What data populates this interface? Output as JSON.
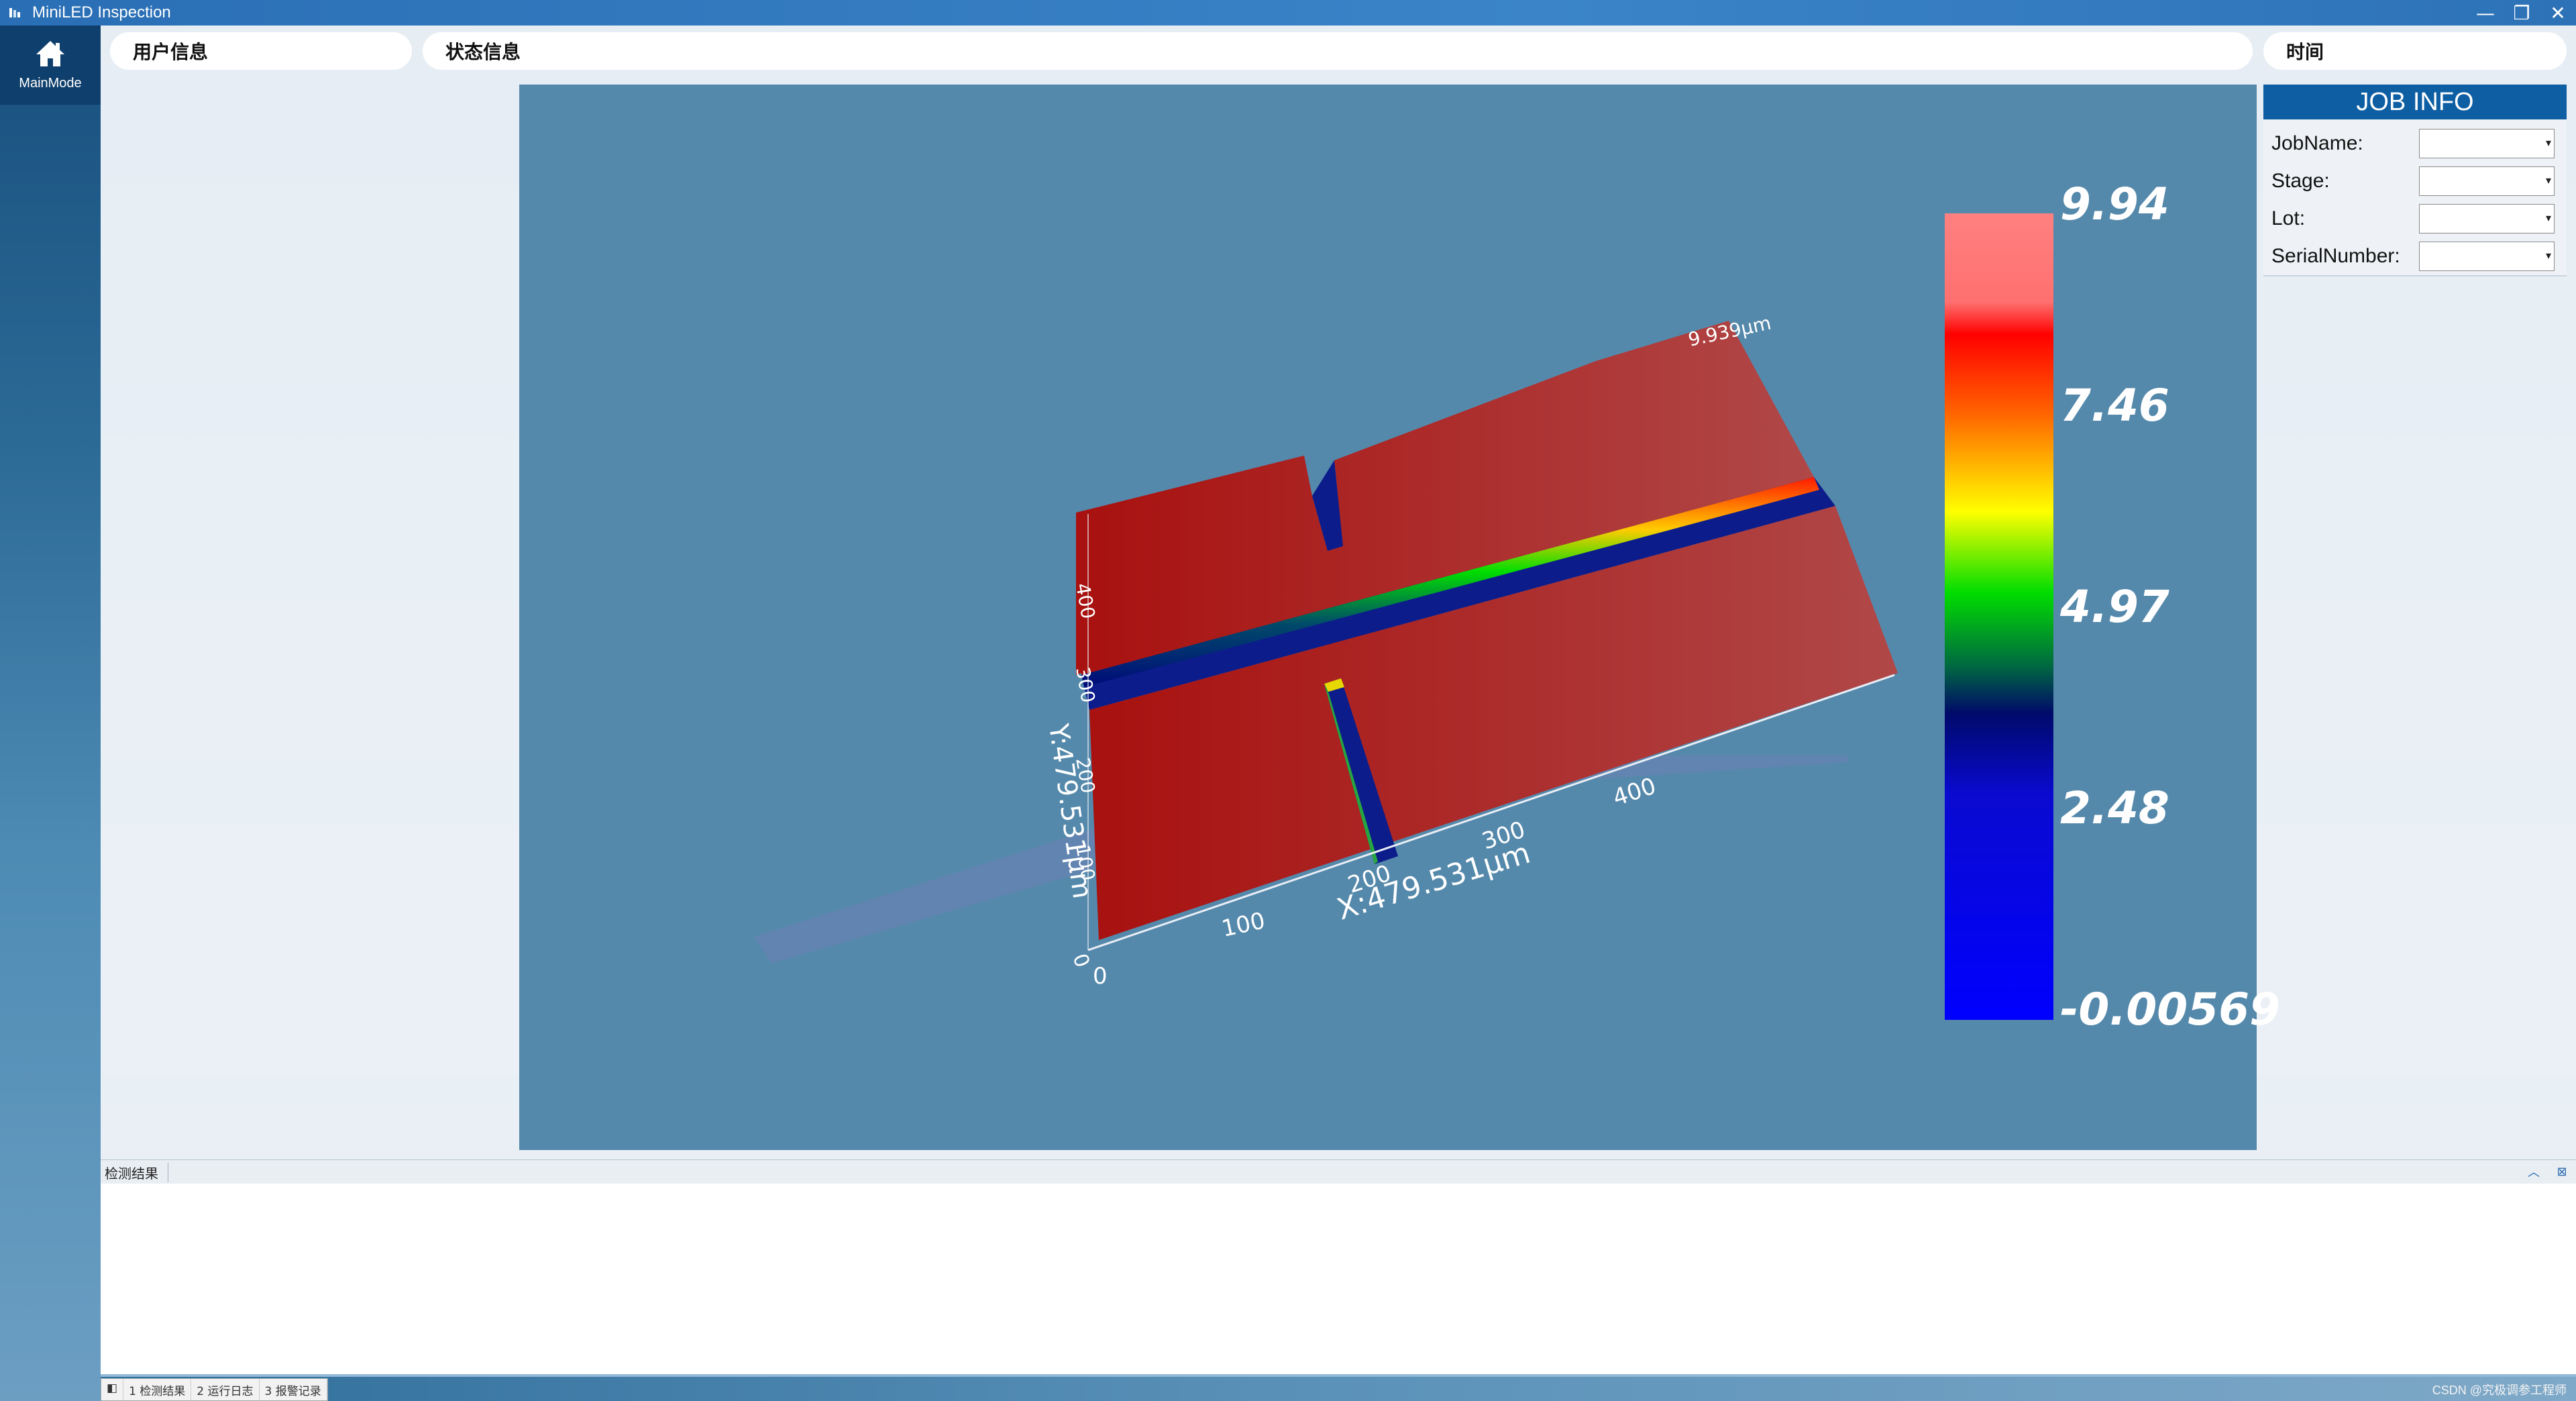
{
  "window": {
    "title": "MiniLED Inspection",
    "minimize": "—",
    "restore": "❐",
    "close": "✕"
  },
  "sidebar": {
    "mode_label": "MainMode"
  },
  "header": {
    "user_info": "用户信息",
    "status_info": "状态信息",
    "time": "时间"
  },
  "viewer": {
    "axis_x_label": "X:479.531μm",
    "axis_y_label": "Y:479.531μm",
    "axis_z_label": "9.939μm",
    "x_ticks": [
      "0",
      "100",
      "200",
      "300",
      "400"
    ],
    "y_ticks": [
      "0",
      "100",
      "200",
      "300",
      "400"
    ],
    "colorbar_labels": [
      "9.94",
      "7.46",
      "4.97",
      "2.48",
      "-0.00569"
    ]
  },
  "job_info": {
    "title": "JOB INFO",
    "fields": [
      {
        "label": "JobName:",
        "value": ""
      },
      {
        "label": "Stage:",
        "value": ""
      },
      {
        "label": "Lot:",
        "value": ""
      },
      {
        "label": "SerialNumber:",
        "value": ""
      }
    ]
  },
  "results": {
    "title": "检测结果",
    "tabs": [
      "1 检测结果",
      "2 运行日志",
      "3 报警记录"
    ]
  },
  "watermark": "CSDN @究极调参工程师",
  "colors": {
    "title_bar": "#2d72b6",
    "viewer_bg": "#5589ab",
    "job_header": "#0e5ea3",
    "surface_red": "#b5201f",
    "trench_blue": "#0a1a9e"
  }
}
